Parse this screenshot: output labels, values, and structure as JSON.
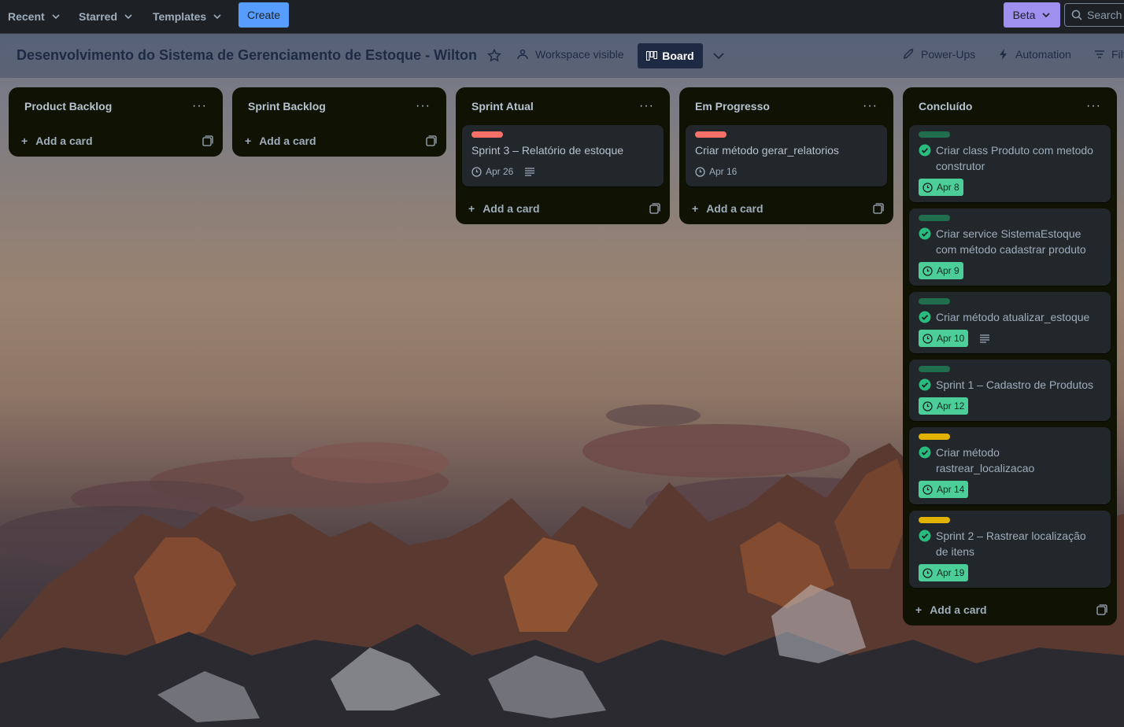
{
  "nav": {
    "recent": "Recent",
    "starred": "Starred",
    "templates": "Templates",
    "create": "Create",
    "beta": "Beta",
    "search_placeholder": "Search"
  },
  "header": {
    "title": "Desenvolvimento do Sistema de Gerenciamento de Estoque - Wilton",
    "visibility": "Workspace visible",
    "view": "Board",
    "powerups": "Power-Ups",
    "automation": "Automation",
    "filters": "Filters"
  },
  "colors": {
    "red_label": "#f87168",
    "green_label": "#216e4e",
    "yellow_label": "#e2b203",
    "done_date": "#4bce97",
    "check": "#2abb7f"
  },
  "add_card": "Add a card",
  "lists": [
    {
      "title": "Product Backlog",
      "cards": []
    },
    {
      "title": "Sprint Backlog",
      "cards": []
    },
    {
      "title": "Sprint Atual",
      "cards": [
        {
          "title": "Sprint 3 – Relatório de estoque",
          "date": "Apr 26"
        }
      ]
    },
    {
      "title": "Em Progresso",
      "cards": [
        {
          "title": "Criar método gerar_relatorios",
          "date": "Apr 16"
        }
      ]
    },
    {
      "title": "Concluído",
      "cards": [
        {
          "title": "Criar class Produto com metodo construtor",
          "date": "Apr 8"
        },
        {
          "title": "Criar service SistemaEstoque com método cadastrar produto",
          "date": "Apr 9"
        },
        {
          "title": "Criar método atualizar_estoque",
          "date": "Apr 10"
        },
        {
          "title": "Sprint 1 – Cadastro de Produtos",
          "date": "Apr 12"
        },
        {
          "title": "Criar método rastrear_localizacao",
          "date": "Apr 14"
        },
        {
          "title": "Sprint 2 – Rastrear localização de itens",
          "date": "Apr 19"
        }
      ]
    }
  ]
}
